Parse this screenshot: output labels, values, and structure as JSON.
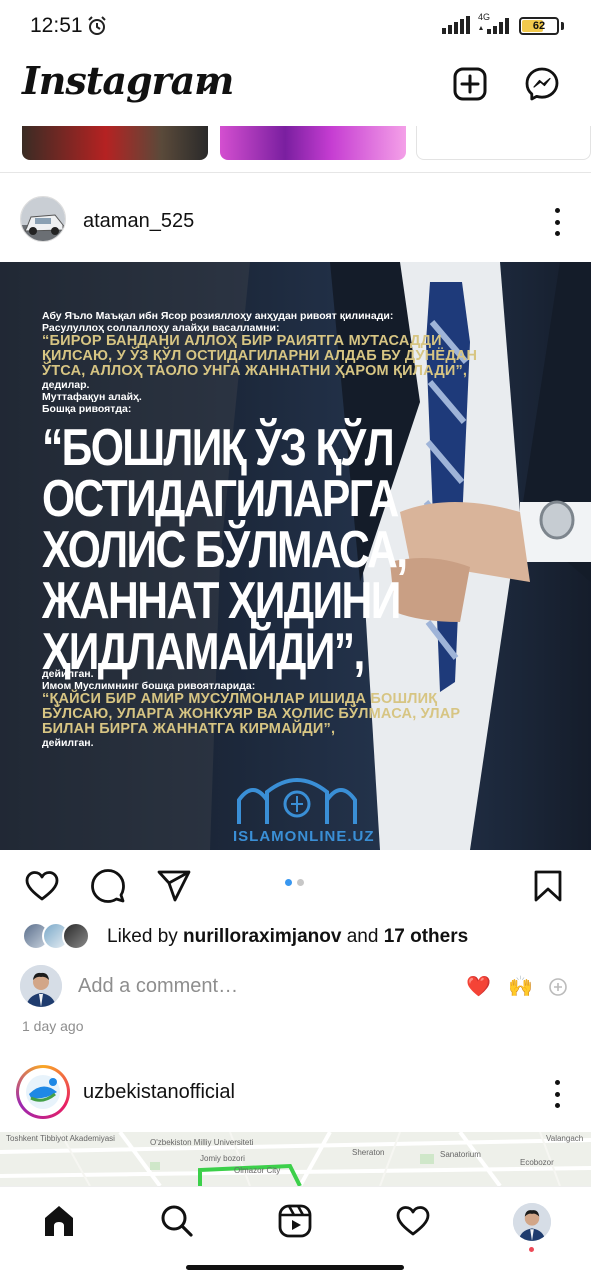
{
  "status_bar": {
    "time": "12:51",
    "network": "4G",
    "battery": "62",
    "battery_fraction": 0.62
  },
  "header": {
    "logo": "Instagram",
    "icons": [
      "chevron-down-icon",
      "new-post-icon",
      "messenger-icon"
    ]
  },
  "post": {
    "username": "ataman_525",
    "image_text": {
      "intro_1": "Абу Яъло Маъқал ибн Ясор розияллоҳу анҳудан ривоят қилинади:",
      "intro_2": "Расулуллоҳ соллаллоҳу алайҳи васалламни:",
      "quote_1": "“Бирор бандани Аллоҳ бир раиятга мутасадди қилсаю, у ўз қўл остидагиларни алдаб бу дунёдан ўтса, Аллоҳ таоло унга жаннатни ҳаром қилади”,",
      "after_1": "дедилар.",
      "after_2": "Муттафақун алайҳ.",
      "after_3": "Бошқа ривоятда:",
      "big_quote": "“Бошлиқ ўз қўл остидагиларга холис бўлмаса, жаннат ҳидини ҳидламайди”,",
      "after_4": "дейилган.",
      "after_5": "Имом Муслимнинг бошқа ривоятларида:",
      "quote_2": "“Қайси бир амир мусулмонлар ишида бошлиқ бўлсаю, уларга жонкуяр ва холис бўлмаса, улар билан бирга жаннатга кирмайди”,",
      "after_6": "дейилган.",
      "watermark": "ISLAMONLINE.UZ"
    },
    "carousel": {
      "count": 2,
      "active": 1
    },
    "liked_by_prefix": "Liked by ",
    "liked_by_user": "nurilloraximjanov",
    "liked_by_and": " and ",
    "liked_by_others": "17 others",
    "comment_placeholder": "Add a comment…",
    "quick_reactions": [
      "❤️",
      "🙌"
    ],
    "time_ago": "1 day ago"
  },
  "next_post": {
    "username": "uzbekistanofficial",
    "map_labels": [
      "Toshkent Tibbiyot Akademiyasi",
      "O'zbekiston Milliy Universiteti",
      "Jomiy bozori",
      "Olmazor City",
      "Sheraton",
      "Sanatorium",
      "Ecobozor",
      "Valangach"
    ]
  },
  "bottom_nav": {
    "items": [
      "home-icon",
      "search-icon",
      "reels-icon",
      "activity-icon",
      "profile-avatar"
    ]
  },
  "colors": {
    "accent_blue": "#3897f0",
    "like_red": "#ed4956",
    "quote_gold": "#d7c583",
    "text_primary": "#111111",
    "text_secondary": "#8e8e8e"
  }
}
